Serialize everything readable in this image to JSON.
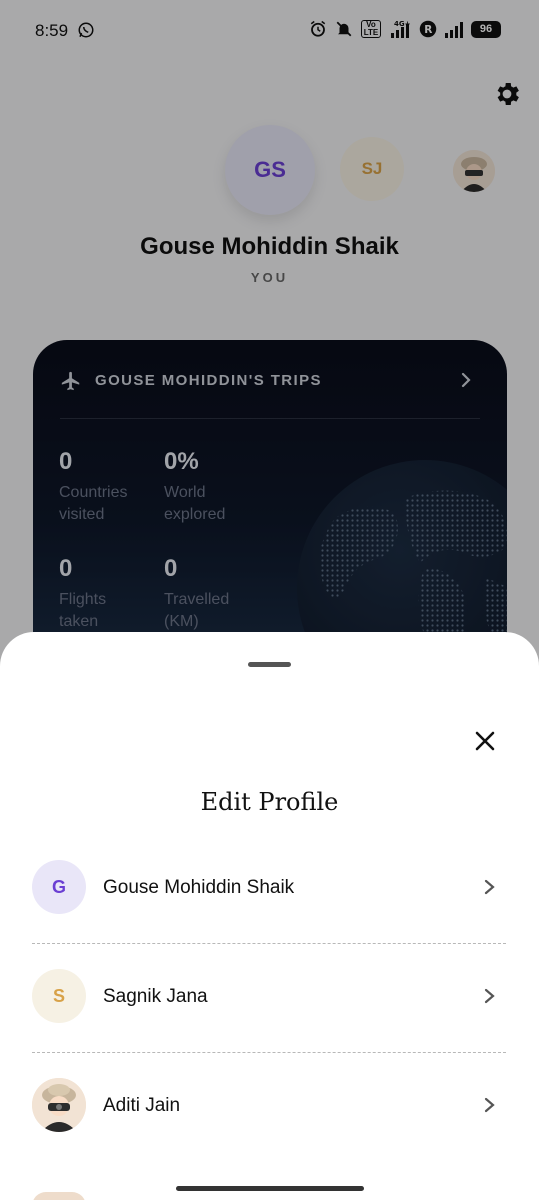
{
  "status_bar": {
    "time": "8:59",
    "battery": "96",
    "network": "4G+",
    "volte": "Vo LTE",
    "icons": [
      "whatsapp-icon",
      "alarm-icon",
      "mute-icon",
      "signal-icon",
      "r-badge-icon",
      "signal-icon",
      "battery-icon"
    ]
  },
  "profile": {
    "avatars": [
      {
        "initials": "GS",
        "color": "#6b3fd3",
        "bg": "#e6e5f5",
        "selected": true
      },
      {
        "initials": "SJ",
        "color": "#d8a248",
        "bg": "#f5efe2",
        "selected": false
      },
      {
        "initials": "",
        "photo": true,
        "selected": false
      }
    ],
    "name": "Gouse Mohiddin Shaik",
    "tag": "YOU"
  },
  "trips_card": {
    "title": "GOUSE MOHIDDIN'S TRIPS",
    "stats": [
      {
        "value": "0",
        "label": "Countries visited"
      },
      {
        "value": "0%",
        "label": "World explored"
      },
      {
        "value": "0",
        "label": "Flights taken"
      },
      {
        "value": "0",
        "label": "Travelled (KM)"
      }
    ]
  },
  "sheet": {
    "title": "Edit Profile",
    "profiles": [
      {
        "initial": "G",
        "name": "Gouse Mohiddin Shaik",
        "color": "#6b3fd3",
        "bg": "#e9e6f8"
      },
      {
        "initial": "S",
        "name": "Sagnik Jana",
        "color": "#d8a248",
        "bg": "#f6f1e4"
      },
      {
        "initial": "",
        "name": "Aditi Jain",
        "photo": true
      }
    ]
  }
}
